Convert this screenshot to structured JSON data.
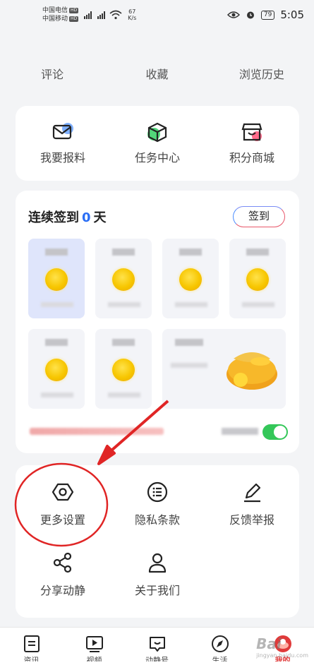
{
  "status_bar": {
    "carrier1": "中国电信",
    "carrier2": "中国移动",
    "hd_badge": "HD",
    "net_type": "4G",
    "speed_value": "67",
    "speed_unit": "K/s",
    "battery": "79",
    "time": "5:05"
  },
  "top_links": [
    "评论",
    "收藏",
    "浏览历史"
  ],
  "actions": [
    {
      "label": "我要报料",
      "icon": "envelope-icon"
    },
    {
      "label": "任务中心",
      "icon": "box-icon"
    },
    {
      "label": "积分商城",
      "icon": "shop-icon"
    }
  ],
  "checkin": {
    "title_prefix": "连续签到",
    "days": "0",
    "title_suffix": "天",
    "button": "签到"
  },
  "settings": [
    {
      "label": "更多设置",
      "icon": "hexagon-settings-icon"
    },
    {
      "label": "隐私条款",
      "icon": "list-circle-icon"
    },
    {
      "label": "反馈举报",
      "icon": "pencil-icon"
    },
    {
      "label": "分享动静",
      "icon": "share-icon"
    },
    {
      "label": "关于我们",
      "icon": "person-icon"
    }
  ],
  "bottom_nav": [
    {
      "label": "资讯",
      "icon": "news-icon"
    },
    {
      "label": "视频",
      "icon": "video-icon"
    },
    {
      "label": "动静号",
      "icon": "chat-icon"
    },
    {
      "label": "生活",
      "icon": "compass-icon"
    },
    {
      "label": "我的",
      "icon": "profile-icon",
      "active": true
    }
  ],
  "watermark": {
    "brand": "Bai",
    "url": "jingyan.baidu.com"
  },
  "colors": {
    "accent_blue": "#2a6ef5",
    "annotation_red": "#e02525",
    "toggle_green": "#34c759",
    "active_red": "#e03a3a"
  }
}
